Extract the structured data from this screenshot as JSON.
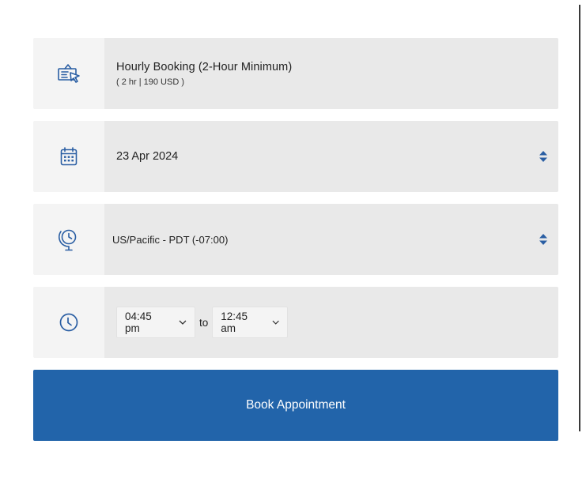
{
  "service": {
    "title": "Hourly Booking (2-Hour Minimum)",
    "subtitle": "( 2 hr | 190 USD )",
    "icon": "booking-sign-icon"
  },
  "date": {
    "value": "23 Apr 2024",
    "icon": "calendar-icon"
  },
  "timezone": {
    "value": "US/Pacific - PDT (-07:00)",
    "icon": "globe-clock-icon"
  },
  "time": {
    "start": "04:45 pm",
    "separator": "to",
    "end": "12:45 am",
    "icon": "clock-icon"
  },
  "actions": {
    "book_label": "Book Appointment"
  },
  "colors": {
    "accent": "#2264aa",
    "field_bg": "#e9e9e9",
    "icon_bg": "#f4f4f4"
  }
}
